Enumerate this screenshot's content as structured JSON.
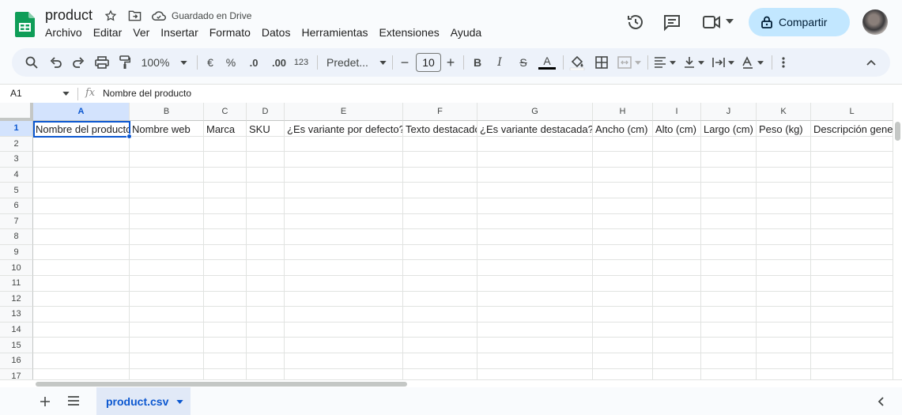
{
  "app": {
    "title": "product",
    "save_status": "Guardado en Drive",
    "share_label": "Compartir"
  },
  "menu": [
    "Archivo",
    "Editar",
    "Ver",
    "Insertar",
    "Formato",
    "Datos",
    "Herramientas",
    "Extensiones",
    "Ayuda"
  ],
  "toolbar": {
    "zoom": "100%",
    "currency": "€",
    "percent": "%",
    "dec_decrease": ".0",
    "dec_increase": ".00",
    "number_format": "123",
    "font": "Predet...",
    "font_size": "10",
    "minus": "−",
    "plus": "+",
    "bold": "B",
    "italic": "I",
    "strike": "S",
    "text_color_letter": "A",
    "text_color": "#000000",
    "icons": [
      "search-icon",
      "undo-icon",
      "redo-icon",
      "print-icon",
      "paint-format-icon",
      "fill-color-icon",
      "borders-icon",
      "merge-icon",
      "align-icon",
      "valign-icon",
      "wrap-icon",
      "rotate-icon",
      "more-icon",
      "collapse-icon"
    ]
  },
  "formula_bar": {
    "name_box": "A1",
    "fx": "fx",
    "value": "Nombre del producto"
  },
  "grid": {
    "columns": [
      "A",
      "B",
      "C",
      "D",
      "E",
      "F",
      "G",
      "H",
      "I",
      "J",
      "K",
      "L"
    ],
    "rows": [
      "1",
      "2",
      "3",
      "4",
      "5",
      "6",
      "7",
      "8",
      "9",
      "10",
      "11",
      "12",
      "13",
      "14",
      "15",
      "16",
      "17"
    ],
    "row1": [
      "Nombre del producto",
      "Nombre web",
      "Marca",
      "SKU",
      "¿Es variante por defecto? (",
      "Texto destacado",
      "¿Es variante destacada? (",
      "Ancho (cm)",
      "Alto (cm)",
      "Largo (cm)",
      "Peso (kg)",
      "Descripción general"
    ],
    "selected_cell": "A1"
  },
  "sheets": {
    "active": "product.csv"
  },
  "colors": {
    "accent": "#0b57d0",
    "share_bg": "#c2e7ff",
    "toolbar_bg": "#edf2fa"
  }
}
